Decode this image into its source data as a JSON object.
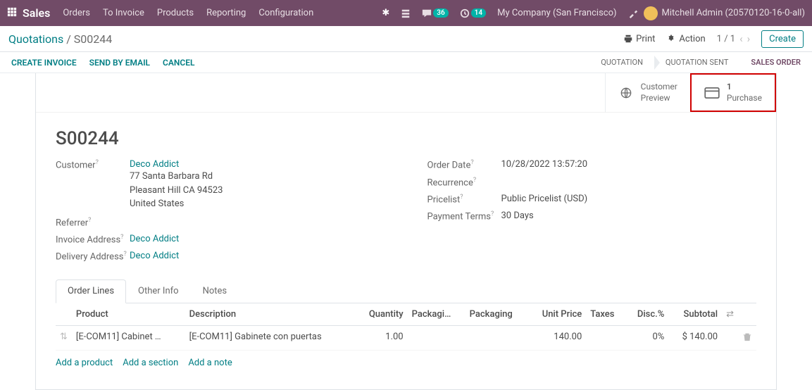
{
  "topbar": {
    "brand": "Sales",
    "nav": [
      "Orders",
      "To Invoice",
      "Products",
      "Reporting",
      "Configuration"
    ],
    "msg_count": "36",
    "clock_count": "14",
    "company": "My Company (San Francisco)",
    "user": "Mitchell Admin (20570120-16-0-all)"
  },
  "breadcrumb": {
    "root": "Quotations",
    "current": "S00244"
  },
  "subbar": {
    "print": "Print",
    "action": "Action",
    "pager": "1 / 1",
    "create": "Create"
  },
  "statusbar": {
    "buttons": [
      "Create Invoice",
      "Send by Email",
      "Cancel"
    ],
    "steps": [
      "Quotation",
      "Quotation Sent",
      "Sales Order"
    ]
  },
  "button_box": {
    "preview": {
      "line1": "Customer",
      "line2": "Preview"
    },
    "purchase": {
      "count": "1",
      "label": "Purchase"
    }
  },
  "record": {
    "title": "S00244"
  },
  "left": {
    "customer_label": "Customer",
    "customer_name": "Deco Addict",
    "addr1": "77 Santa Barbara Rd",
    "addr2": "Pleasant Hill CA 94523",
    "addr3": "United States",
    "referrer_label": "Referrer",
    "invoice_label": "Invoice Address",
    "invoice_val": "Deco Addict",
    "delivery_label": "Delivery Address",
    "delivery_val": "Deco Addict"
  },
  "right": {
    "date_label": "Order Date",
    "date_val": "10/28/2022 13:57:20",
    "recurrence_label": "Recurrence",
    "pricelist_label": "Pricelist",
    "pricelist_val": "Public Pricelist (USD)",
    "terms_label": "Payment Terms",
    "terms_val": "30 Days"
  },
  "tabs": [
    "Order Lines",
    "Other Info",
    "Notes"
  ],
  "table": {
    "headers": {
      "product": "Product",
      "desc": "Description",
      "qty": "Quantity",
      "packagi": "Packagi…",
      "packaging": "Packaging",
      "price": "Unit Price",
      "taxes": "Taxes",
      "disc": "Disc.%",
      "subtotal": "Subtotal"
    },
    "rows": [
      {
        "product": "[E-COM11] Cabinet …",
        "desc": "[E-COM11] Gabinete con puertas",
        "qty": "1.00",
        "price": "140.00",
        "disc": "0%",
        "subtotal": "$ 140.00"
      }
    ]
  },
  "add_links": {
    "product": "Add a product",
    "section": "Add a section",
    "note": "Add a note"
  }
}
